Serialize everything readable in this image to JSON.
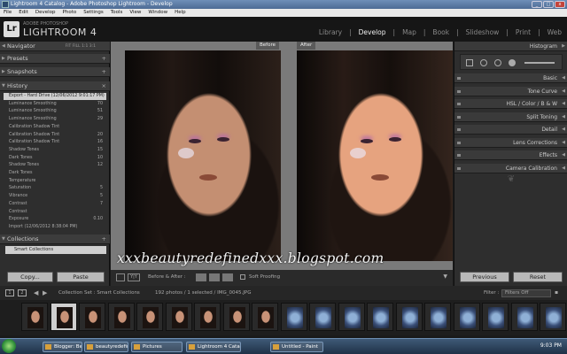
{
  "window": {
    "title": "Lightroom 4 Catalog - Adobe Photoshop Lightroom - Develop",
    "controls": [
      "_",
      "□",
      "x"
    ]
  },
  "menu": [
    "File",
    "Edit",
    "Develop",
    "Photo",
    "Settings",
    "Tools",
    "View",
    "Window",
    "Help"
  ],
  "header": {
    "logo_letters": "Lr",
    "logo_small": "ADOBE PHOTOSHOP",
    "logo_big": "LIGHTROOM 4"
  },
  "modules": [
    {
      "label": "Library",
      "active": false
    },
    {
      "label": "Develop",
      "active": true
    },
    {
      "label": "Map",
      "active": false
    },
    {
      "label": "Book",
      "active": false
    },
    {
      "label": "Slideshow",
      "active": false
    },
    {
      "label": "Print",
      "active": false
    },
    {
      "label": "Web",
      "active": false
    }
  ],
  "left": {
    "navigator": "Navigator",
    "nav_tools": "FIT  FILL  1:1  3:1",
    "presets": "Presets",
    "snapshots": "Snapshots",
    "history": "History",
    "history_items": [
      {
        "label": "Export - Hard Drive (12/06/2012 9:01:17 PM)",
        "a": "",
        "b": "",
        "selected": true
      },
      {
        "label": "Luminance Smoothing",
        "a": "",
        "b": "70"
      },
      {
        "label": "Luminance Smoothing",
        "a": "",
        "b": "51"
      },
      {
        "label": "Luminance Smoothing",
        "a": "",
        "b": "29"
      },
      {
        "label": "Calibration Shadow Tint",
        "a": "",
        "b": ""
      },
      {
        "label": "Calibration Shadow Tint",
        "a": "",
        "b": "20"
      },
      {
        "label": "Calibration Shadow Tint",
        "a": "",
        "b": "16"
      },
      {
        "label": "Shadow Tones",
        "a": "",
        "b": "15"
      },
      {
        "label": "Dark Tones",
        "a": "",
        "b": "10"
      },
      {
        "label": "Shadow Tones",
        "a": "",
        "b": "12"
      },
      {
        "label": "Dark Tones",
        "a": "",
        "b": ""
      },
      {
        "label": "Temperature",
        "a": "",
        "b": ""
      },
      {
        "label": "Saturation",
        "a": "",
        "b": "5"
      },
      {
        "label": "Vibrance",
        "a": "",
        "b": "5"
      },
      {
        "label": "Contrast",
        "a": "",
        "b": "7"
      },
      {
        "label": "Contrast",
        "a": "",
        "b": ""
      },
      {
        "label": "Exposure",
        "a": "",
        "b": "0.10"
      },
      {
        "label": "Import (12/06/2012 8:38:04 PM)",
        "a": "",
        "b": ""
      }
    ],
    "collections": "Collections",
    "smart_collections": "Smart Collections",
    "copy_button": "Copy...",
    "paste_button": "Paste"
  },
  "center": {
    "before_label": "Before",
    "after_label": "After",
    "toolbar_label": "Before & After :",
    "soft_proofing": "Soft Proofing",
    "watermark": "xxxbeautyredefinedxxx.blogspot.com"
  },
  "right": {
    "histogram": "Histogram",
    "panels": [
      "Basic",
      "Tone Curve",
      "HSL / Color / B & W",
      "Split Toning",
      "Detail",
      "Lens Corrections",
      "Effects",
      "Camera Calibration"
    ],
    "previous_button": "Previous",
    "reset_button": "Reset"
  },
  "filmstrip_bar": {
    "path": "Collection Set : Smart Collections",
    "count": "192 photos / 1 selected / IMG_0045.JPG",
    "filter_label": "Filter :",
    "filter_value": "Filters Off"
  },
  "taskbar": {
    "tasks": [
      "Blogger: BeautyRed...",
      "beautyredefined",
      "Pictures",
      "Lightroom 4 Catalo...",
      "Untitled - Paint"
    ],
    "clock": "9:03 PM"
  }
}
